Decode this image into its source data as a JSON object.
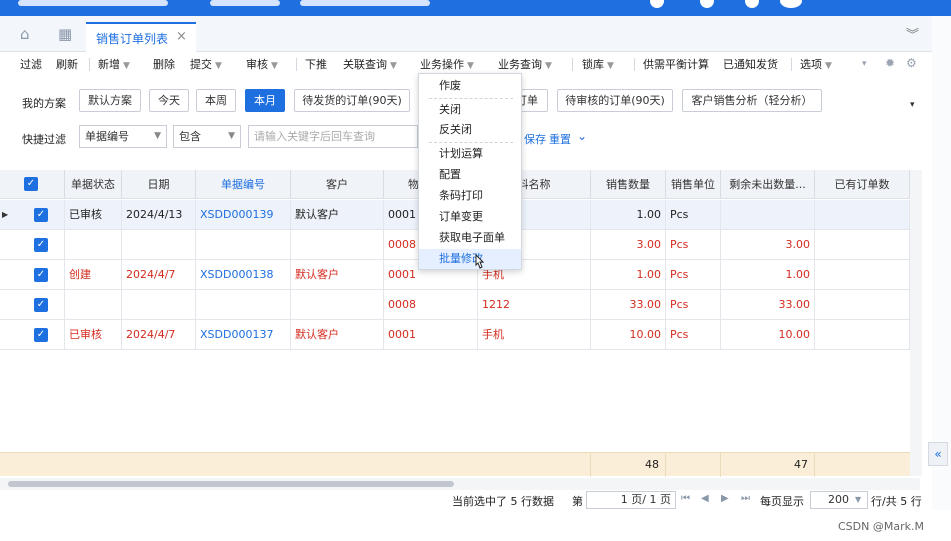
{
  "tabs": {
    "active_label": "销售订单列表",
    "close_glyph": "×"
  },
  "toolbar": {
    "items": [
      "过滤",
      "刷新",
      "新增",
      "删除",
      "提交",
      "审核",
      "下推",
      "关联查询",
      "业务操作",
      "业务查询",
      "锁库",
      "供需平衡计算",
      "已通知发货",
      "选项"
    ]
  },
  "filters": {
    "scheme_label": "我的方案",
    "scheme_buttons": [
      "默认方案",
      "今天",
      "本周",
      "本月",
      "待发货的订单(90天)",
      "订单",
      "待审核的订单(90天)",
      "客户销售分析（轻分析）"
    ],
    "active_scheme": "本月",
    "quick_label": "快捷过滤",
    "field_select": "单据编号",
    "op_select": "包含",
    "search_placeholder": "请输入关键字后回车查询",
    "save_link": "保存",
    "reset_link": "重置"
  },
  "grid": {
    "headers": [
      "单据状态",
      "日期",
      "单据编号",
      "客户",
      "物",
      "料名称",
      "销售数量",
      "销售单位",
      "剩余未出数量...",
      "已有订单数"
    ],
    "rows": [
      {
        "status": "已审核",
        "date": "2024/4/13",
        "billno": "XSDD000139",
        "customer": "默认客户",
        "material": "0001",
        "matname": "",
        "qty": "1.00",
        "unit": "Pcs",
        "remain": "",
        "color": "dark"
      },
      {
        "status": "",
        "date": "",
        "billno": "",
        "customer": "",
        "material": "0008",
        "matname": "",
        "qty": "3.00",
        "unit": "Pcs",
        "remain": "3.00",
        "color": "red"
      },
      {
        "status": "创建",
        "date": "2024/4/7",
        "billno": "XSDD000138",
        "customer": "默认客户",
        "material": "0001",
        "matname": "手机",
        "qty": "1.00",
        "unit": "Pcs",
        "remain": "1.00",
        "color": "red"
      },
      {
        "status": "",
        "date": "",
        "billno": "",
        "customer": "",
        "material": "0008",
        "matname": "1212",
        "qty": "33.00",
        "unit": "Pcs",
        "remain": "33.00",
        "color": "red"
      },
      {
        "status": "已审核",
        "date": "2024/4/7",
        "billno": "XSDD000137",
        "customer": "默认客户",
        "material": "0001",
        "matname": "手机",
        "qty": "10.00",
        "unit": "Pcs",
        "remain": "10.00",
        "color": "red"
      }
    ],
    "sum_qty": "48",
    "sum_remain": "47"
  },
  "menu": {
    "items": [
      "作废",
      "关闭",
      "反关闭",
      "计划运算",
      "配置",
      "条码打印",
      "订单变更",
      "获取电子面单",
      "批量修改"
    ],
    "hovered": "批量修改"
  },
  "pager": {
    "selected_text": "当前选中了 5 行数据",
    "page_label": "第",
    "page_value": "1 页/ 1 页",
    "per_page_label": "每页显示",
    "per_page_value": "200",
    "total_text": "行/共 5 行"
  },
  "watermark": "CSDN @Mark.M"
}
